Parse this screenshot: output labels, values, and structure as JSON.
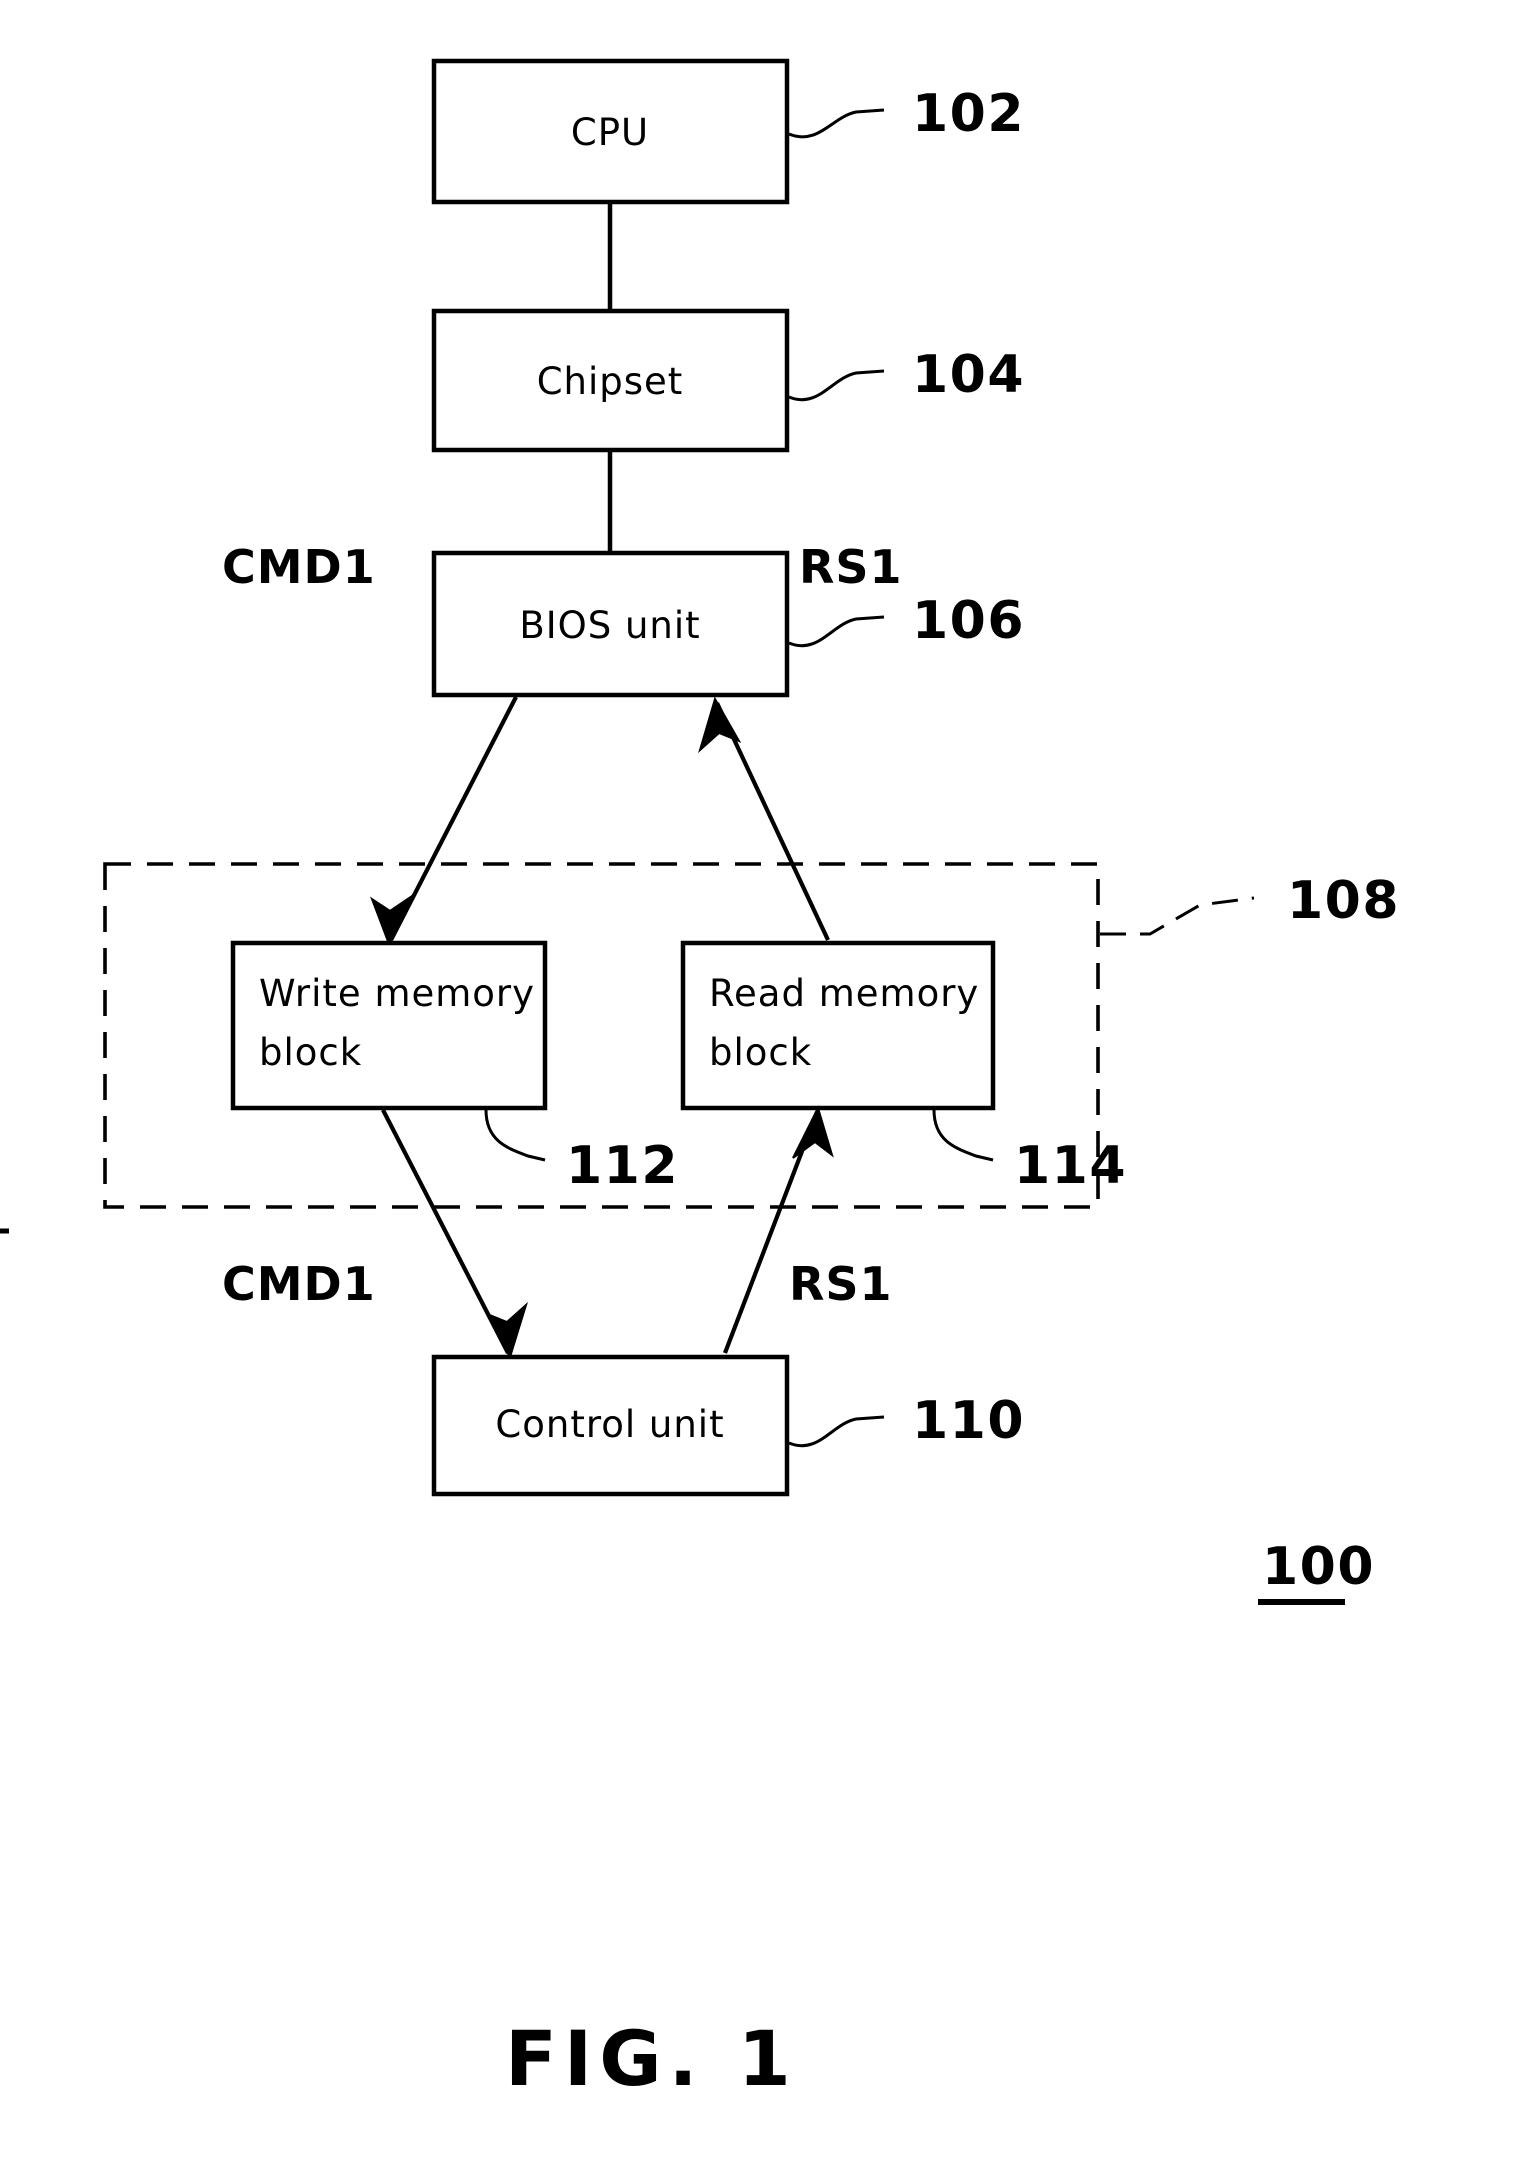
{
  "figure": {
    "caption": "FIG. 1",
    "system_ref": "100"
  },
  "blocks": [
    {
      "id": "cpu",
      "label": "CPU",
      "ref": "102"
    },
    {
      "id": "chipset",
      "label": "Chipset",
      "ref": "104"
    },
    {
      "id": "bios",
      "label": "BIOS unit",
      "ref": "106"
    },
    {
      "id": "write_memory",
      "label_line1": "Write memory",
      "label_line2": "block",
      "ref": "112"
    },
    {
      "id": "read_memory",
      "label_line1": "Read memory",
      "label_line2": "block",
      "ref": "114"
    },
    {
      "id": "control",
      "label": "Control unit",
      "ref": "110"
    }
  ],
  "group": {
    "id": "memory_group",
    "ref": "108",
    "style": "dashed"
  },
  "signals": {
    "cmd_upper": "CMD1",
    "rs_upper": "RS1",
    "cmd_lower": "CMD1",
    "rs_lower": "RS1"
  },
  "colors": {
    "stroke": "#000000",
    "fill": "#ffffff",
    "background": "#ffffff"
  }
}
